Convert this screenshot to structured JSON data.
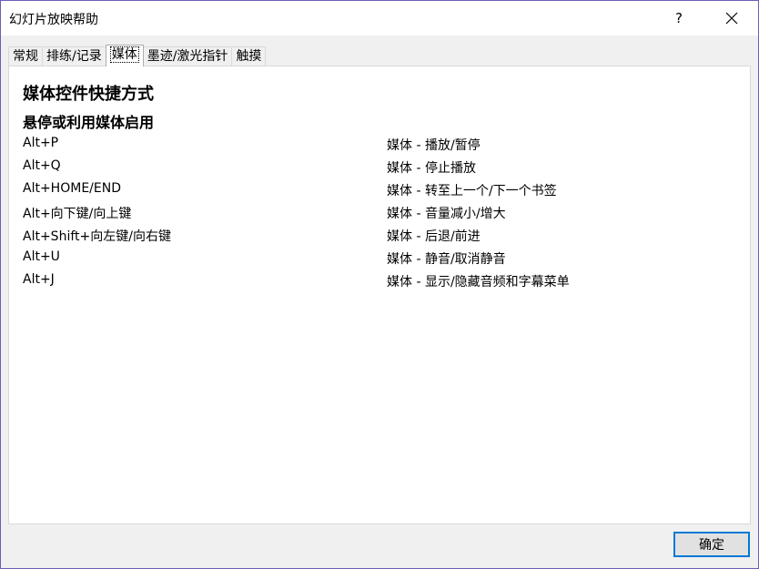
{
  "window": {
    "title": "幻灯片放映帮助",
    "help_label": "?"
  },
  "tabs": [
    {
      "label": "常规"
    },
    {
      "label": "排练/记录"
    },
    {
      "label": "媒体",
      "active": true
    },
    {
      "label": "墨迹/激光指针"
    },
    {
      "label": "触摸"
    }
  ],
  "content": {
    "heading": "媒体控件快捷方式",
    "subheading": "悬停或利用媒体启用",
    "shortcuts": [
      {
        "key": "Alt+P",
        "desc": "媒体 - 播放/暂停"
      },
      {
        "key": "Alt+Q",
        "desc": "媒体 - 停止播放"
      },
      {
        "key": "Alt+HOME/END",
        "desc": "媒体 - 转至上一个/下一个书签"
      },
      {
        "key": "Alt+向下键/向上键",
        "desc": "媒体 - 音量减小/增大"
      },
      {
        "key": "Alt+Shift+向左键/向右键",
        "desc": "媒体 - 后退/前进"
      },
      {
        "key": "Alt+U",
        "desc": "媒体 - 静音/取消静音"
      },
      {
        "key": "Alt+J",
        "desc": "媒体 - 显示/隐藏音频和字幕菜单"
      }
    ]
  },
  "footer": {
    "ok_label": "确定"
  },
  "colors": {
    "accent": "#0078d7",
    "window_border": "#6b5fb5"
  }
}
